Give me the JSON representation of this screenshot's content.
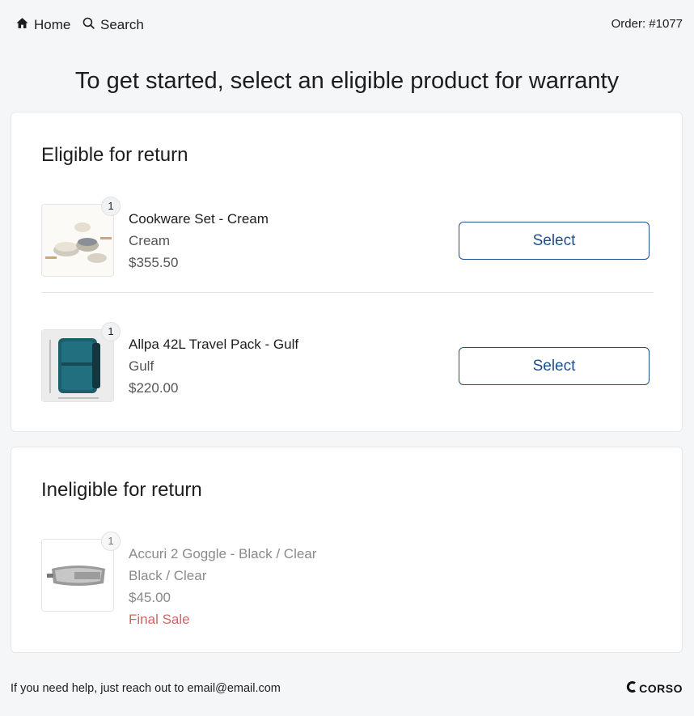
{
  "nav": {
    "home_label": "Home",
    "search_label": "Search",
    "order_label": "Order: #1077",
    "home_icon": "home-icon",
    "search_icon": "search-icon"
  },
  "headline": "To get started, select an eligible product for warranty",
  "eligible": {
    "title": "Eligible for return",
    "items": [
      {
        "quantity": "1",
        "name": "Cookware Set - Cream",
        "variant": "Cream",
        "price": "$355.50",
        "button_label": "Select",
        "image": "cookware-set-image"
      },
      {
        "quantity": "1",
        "name": "Allpa 42L Travel Pack - Gulf",
        "variant": "Gulf",
        "price": "$220.00",
        "button_label": "Select",
        "image": "travel-pack-image"
      }
    ]
  },
  "ineligible": {
    "title": "Ineligible for return",
    "items": [
      {
        "quantity": "1",
        "name": "Accuri 2 Goggle - Black / Clear",
        "variant": "Black / Clear",
        "price": "$45.00",
        "note": "Final Sale",
        "image": "goggle-image"
      }
    ]
  },
  "footer": {
    "help_text": "If you need help, just reach out to email@email.com",
    "logo_text": "CORSO"
  },
  "colors": {
    "accent": "#1f4e8c",
    "final_sale": "#d26464",
    "background": "#f5f6f7"
  }
}
